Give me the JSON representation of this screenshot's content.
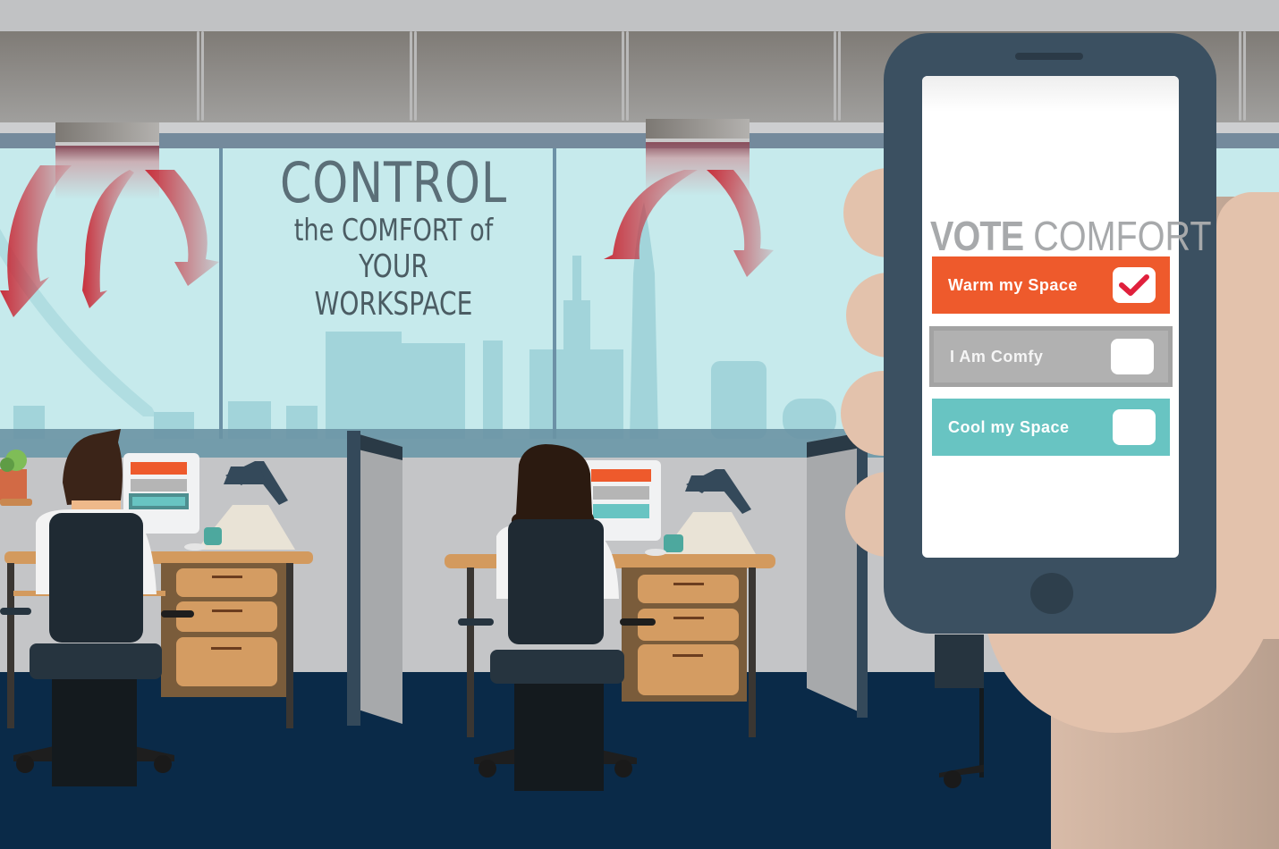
{
  "scene": {
    "description": "Flat illustration of an open office with two workers at desks and a hand holding a smartphone voting app"
  },
  "headline": {
    "line1": "CONTROL",
    "line2": "the COMFORT of",
    "line3": "YOUR WORKSPACE"
  },
  "phone_app": {
    "title_bold": "VOTE",
    "title_light": "COMFORT",
    "options": [
      {
        "label": "Warm my Space",
        "checked": true,
        "color": "#ee5a2c"
      },
      {
        "label": "I Am Comfy",
        "checked": false,
        "color": "#b1b1b1"
      },
      {
        "label": "Cool my Space",
        "checked": false,
        "color": "#68c4c2"
      }
    ],
    "check_color": "#e0203c"
  },
  "colors": {
    "warm_arrow": "#c8303c",
    "floor": "#0a2a48",
    "phone_body": "#3b5061",
    "window_glass": "#c6eaec",
    "skyline": "#a2d4da"
  }
}
